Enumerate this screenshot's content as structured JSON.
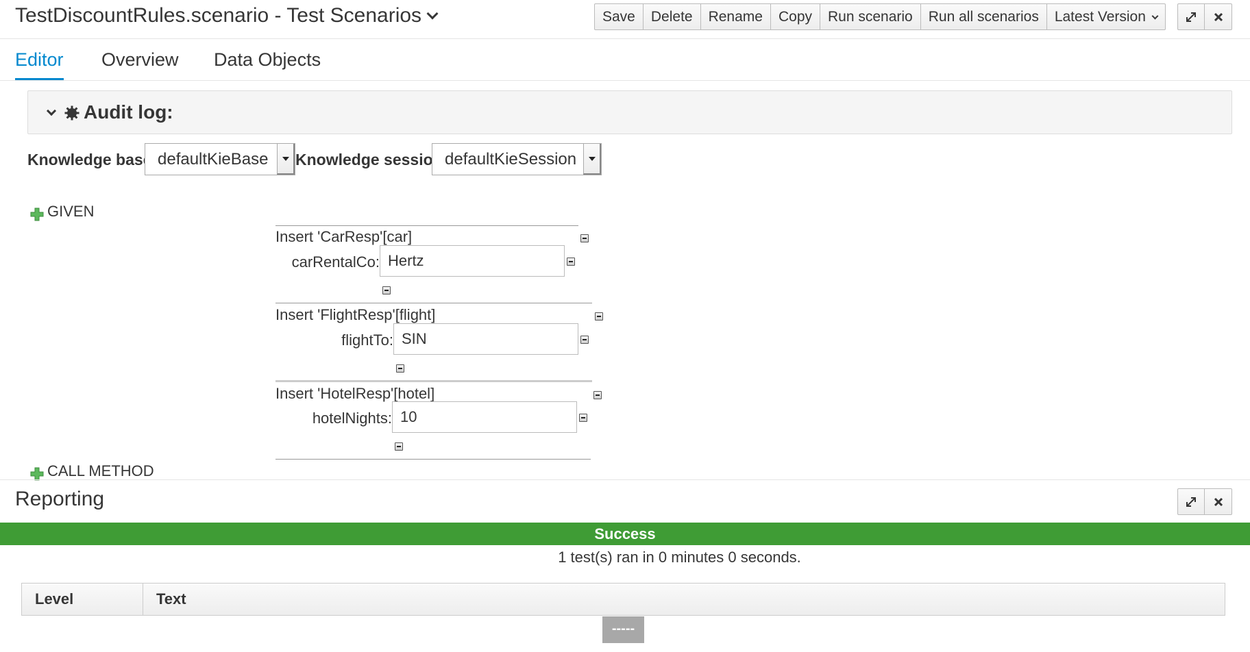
{
  "header": {
    "title": "TestDiscountRules.scenario - Test Scenarios",
    "toolbar": {
      "save": "Save",
      "delete": "Delete",
      "rename": "Rename",
      "copy": "Copy",
      "run_scenario": "Run scenario",
      "run_all": "Run all scenarios",
      "version": "Latest Version"
    }
  },
  "tabs": [
    {
      "label": "Editor",
      "active": true
    },
    {
      "label": "Overview",
      "active": false
    },
    {
      "label": "Data Objects",
      "active": false
    }
  ],
  "audit": {
    "label": "Audit log:"
  },
  "knowledge": {
    "base_label": "Knowledge base",
    "base_value": "defaultKieBase",
    "session_label": "Knowledge session",
    "session_value": "defaultKieSession"
  },
  "given": {
    "label": "GIVEN",
    "facts": [
      {
        "title": "Insert 'CarResp'[car]",
        "field": "carRentalCo:",
        "value": "Hertz"
      },
      {
        "title": "Insert 'FlightResp'[flight]",
        "field": "flightTo:",
        "value": "SIN"
      },
      {
        "title": "Insert 'HotelResp'[hotel]",
        "field": "hotelNights:",
        "value": "10"
      }
    ]
  },
  "call_method": {
    "label": "CALL METHOD"
  },
  "reporting": {
    "title": "Reporting",
    "status": "Success",
    "summary": "1 test(s) ran in 0 minutes 0 seconds.",
    "columns": [
      "Level",
      "Text"
    ],
    "pager": "-----"
  },
  "colors": {
    "accent": "#0088ce",
    "success": "#3f9c35",
    "plus_icon": "#5cb85c"
  },
  "icons": {
    "maximize": "expand-arrows-icon",
    "close": "close-icon",
    "audit": "gear-icon",
    "add": "plus-icon",
    "remove": "minus-icon"
  }
}
